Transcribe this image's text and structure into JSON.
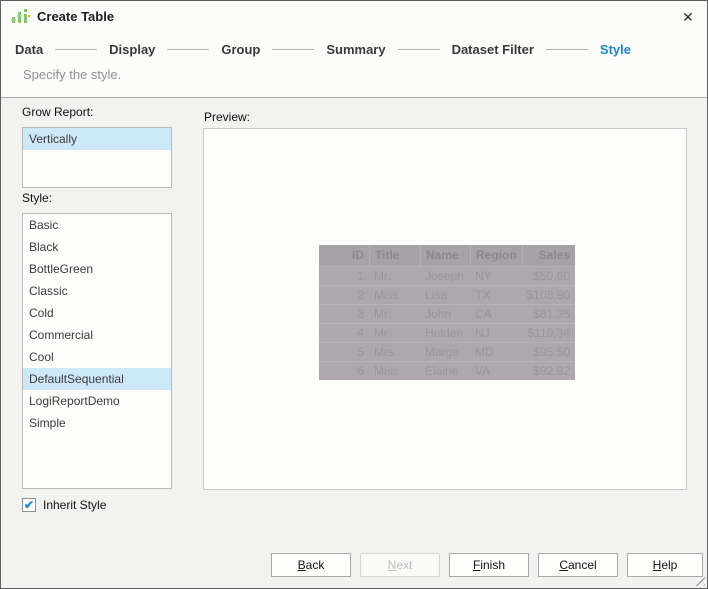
{
  "window": {
    "title": "Create Table",
    "close_glyph": "✕"
  },
  "steps": [
    {
      "label": "Data",
      "active": false
    },
    {
      "label": "Display",
      "active": false
    },
    {
      "label": "Group",
      "active": false
    },
    {
      "label": "Summary",
      "active": false
    },
    {
      "label": "Dataset Filter",
      "active": false
    },
    {
      "label": "Style",
      "active": true
    }
  ],
  "subtitle": "Specify the style.",
  "grow_report": {
    "label": "Grow Report:",
    "options": [
      "Vertically"
    ],
    "selected": "Vertically"
  },
  "style_list": {
    "label": "Style:",
    "options": [
      "Basic",
      "Black",
      "BottleGreen",
      "Classic",
      "Cold",
      "Commercial",
      "Cool",
      "DefaultSequential",
      "LogiReportDemo",
      "Simple"
    ],
    "selected": "DefaultSequential"
  },
  "inherit_style": {
    "label": "Inherit Style",
    "checked": true,
    "check_glyph": "✔"
  },
  "preview": {
    "label": "Preview:",
    "table": {
      "columns": [
        "ID",
        "Title",
        "Name",
        "Region",
        "Sales"
      ],
      "rows": [
        [
          "1",
          "Mr.",
          "Joseph",
          "NY",
          "$50,60"
        ],
        [
          "2",
          "Miss.",
          "Lisa",
          "TX",
          "$108,90"
        ],
        [
          "3",
          "Mr.",
          "John",
          "CA",
          "$81,35"
        ],
        [
          "4",
          "Mr.",
          "Holden",
          "NJ",
          "$110,34"
        ],
        [
          "5",
          "Mrs.",
          "Marge",
          "MD",
          "$95.50"
        ],
        [
          "6",
          "Miss.",
          "Elaine",
          "VA",
          "$92.82"
        ]
      ]
    }
  },
  "buttons": [
    {
      "label": "Back",
      "enabled": true
    },
    {
      "label": "Next",
      "enabled": false
    },
    {
      "label": "Finish",
      "enabled": true
    },
    {
      "label": "Cancel",
      "enabled": true
    },
    {
      "label": "Help",
      "enabled": true
    }
  ],
  "colors": {
    "accent_blue": "#1b86d3",
    "selection_blue": "#cde8f6",
    "icon_green": "#85c46f",
    "preview_table_gray": "#aca8ac"
  }
}
